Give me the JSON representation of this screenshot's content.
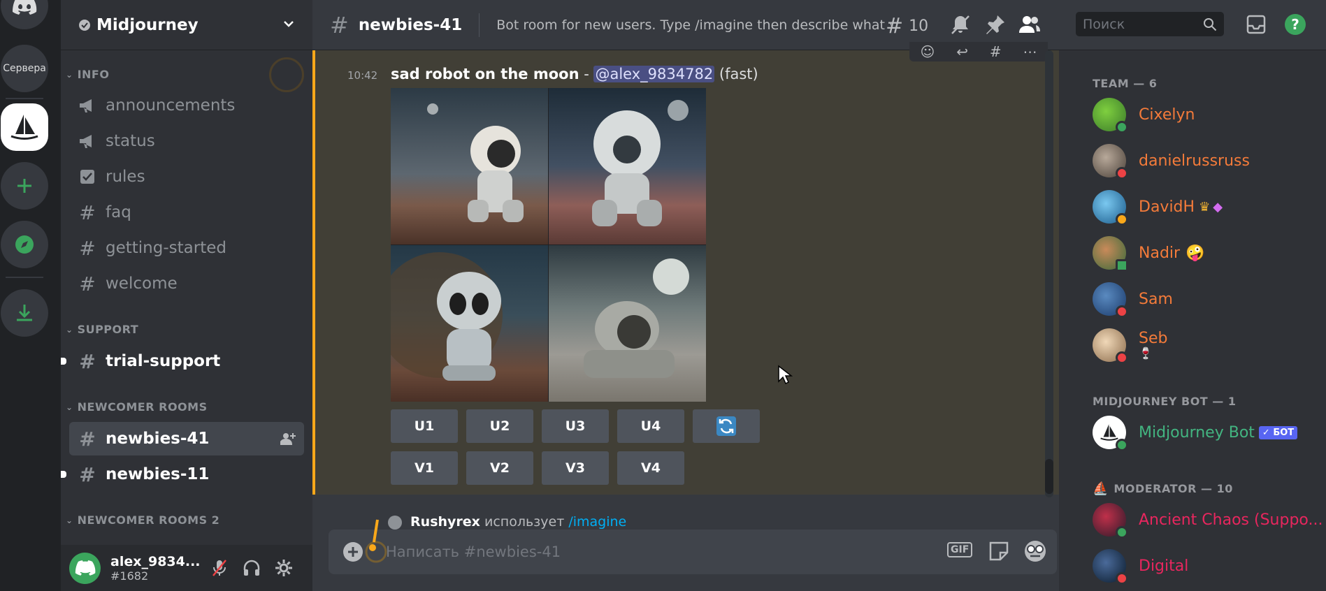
{
  "servers": {
    "label": "Сервера"
  },
  "guild": {
    "name": "Midjourney"
  },
  "sidebar": {
    "categories": [
      {
        "label": "INFO"
      },
      {
        "label": "SUPPORT"
      },
      {
        "label": "NEWCOMER ROOMS"
      },
      {
        "label": "NEWCOMER ROOMS 2"
      }
    ],
    "channels": [
      {
        "label": "announcements"
      },
      {
        "label": "status"
      },
      {
        "label": "rules"
      },
      {
        "label": "faq"
      },
      {
        "label": "getting-started"
      },
      {
        "label": "welcome"
      },
      {
        "label": "trial-support"
      },
      {
        "label": "newbies-41"
      },
      {
        "label": "newbies-11"
      }
    ]
  },
  "user": {
    "name": "alex_9834...",
    "tag": "#1682"
  },
  "header": {
    "channel": "newbies-41",
    "topic": "Bot room for new users. Type /imagine then describe what yo...",
    "threads_count": "10",
    "search_placeholder": "Поиск"
  },
  "message": {
    "time": "10:42",
    "prompt": "sad robot on the moon",
    "separator": " - ",
    "mention": "@alex_9834782",
    "mode": "(fast)",
    "upscale_buttons": [
      "U1",
      "U2",
      "U3",
      "U4"
    ],
    "variation_buttons": [
      "V1",
      "V2",
      "V3",
      "V4"
    ]
  },
  "next_message": {
    "author": "Rushyrex",
    "text": "использует",
    "command": "/imagine"
  },
  "composer": {
    "placeholder": "Написать #newbies-41",
    "gif_label": "GIF"
  },
  "members": {
    "team_header": "TEAM — 6",
    "team": [
      {
        "name": "Cixelyn",
        "color": "#f47b3a",
        "status": "#3ba55d"
      },
      {
        "name": "danielrussruss",
        "color": "#f47b3a",
        "status": "#ed4245"
      },
      {
        "name": "DavidH",
        "color": "#f47b3a",
        "status": "#faa81a"
      },
      {
        "name": "Nadir",
        "color": "#f47b3a",
        "status": "#3ba55d"
      },
      {
        "name": "Sam",
        "color": "#f47b3a",
        "status": "#ed4245"
      },
      {
        "name": "Seb",
        "color": "#f47b3a",
        "status": "#ed4245"
      }
    ],
    "bot_header": "MIDJOURNEY BOT — 1",
    "bot": {
      "name": "Midjourney Bot",
      "tag": "✓ БОТ",
      "color": "#43b581"
    },
    "mod_header": "MODERATOR — 10",
    "mods": [
      {
        "name": "Ancient Chaos (Suppo...",
        "color": "#e8265e"
      },
      {
        "name": "Digital",
        "color": "#e8265e"
      }
    ]
  },
  "colors": {
    "accent": "#5865f2",
    "highlight_border": "#faa81a",
    "online": "#3ba55d",
    "dnd": "#ed4245"
  }
}
